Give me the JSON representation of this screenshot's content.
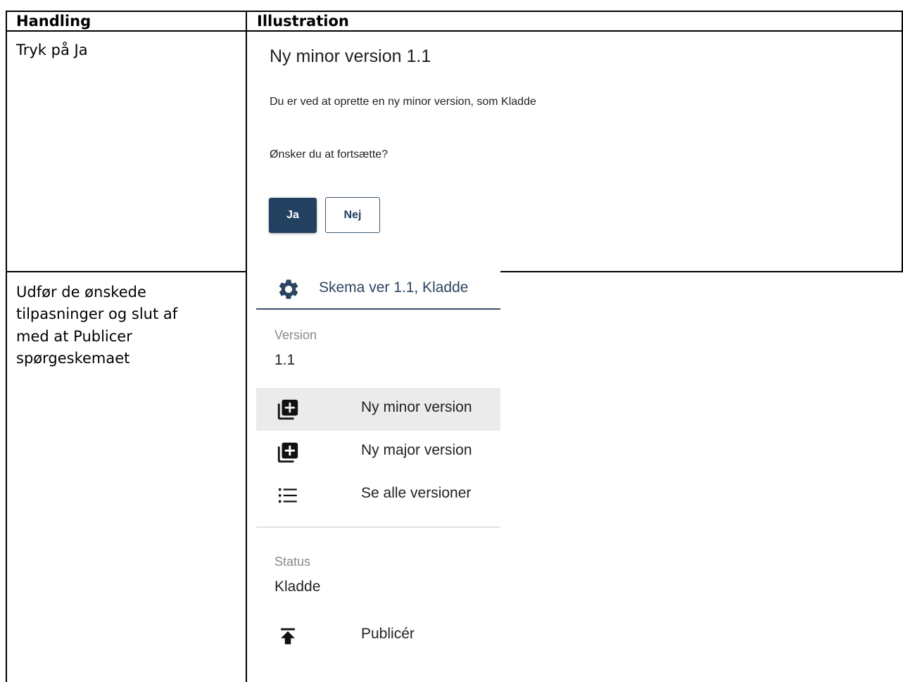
{
  "table": {
    "headers": [
      "Handling",
      "Illustration"
    ],
    "rows": [
      {
        "action": "Tryk på Ja"
      },
      {
        "action_lines": [
          "Udfør de ønskede",
          "tilpasninger og slut af",
          "med at Publicer",
          "spørgeskemaet"
        ]
      }
    ]
  },
  "dialog": {
    "title": "Ny minor version 1.1",
    "message": "Du er ved at oprette en ny minor version, som Kladde",
    "question": "Ønsker du at fortsætte?",
    "yes_label": "Ja",
    "no_label": "Nej",
    "colors": {
      "primary": "#22405f"
    }
  },
  "panel": {
    "header": {
      "icon": "gear-icon",
      "title": "Skema ver 1.1, Kladde"
    },
    "version": {
      "label": "Version",
      "value": "1.1"
    },
    "menu": [
      {
        "icon": "library-add-icon",
        "label": "Ny minor version",
        "active": true
      },
      {
        "icon": "library-add-icon",
        "label": "Ny major version",
        "active": false
      },
      {
        "icon": "list-icon",
        "label": "Se alle versioner",
        "active": false
      }
    ],
    "status": {
      "label": "Status",
      "value": "Kladde"
    },
    "publish": {
      "icon": "publish-icon",
      "label": "Publicér"
    }
  }
}
